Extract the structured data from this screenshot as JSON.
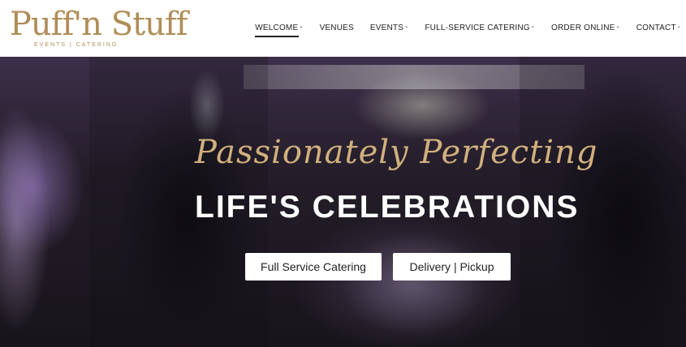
{
  "logo": {
    "main": "Puff'n Stuff",
    "sub": "EVENTS | CATERING"
  },
  "nav": {
    "items": [
      {
        "label": "WELCOME",
        "caret": "⌄"
      },
      {
        "label": "VENUES",
        "caret": ""
      },
      {
        "label": "EVENTS",
        "caret": "⌄"
      },
      {
        "label": "FULL-SERVICE CATERING",
        "caret": "⌄"
      },
      {
        "label": "ORDER ONLINE",
        "caret": "⌄"
      },
      {
        "label": "CONTACT",
        "caret": "⌄"
      }
    ]
  },
  "hero": {
    "script_line": "Passionately Perfecting",
    "main_line": "LIFE'S CELEBRATIONS",
    "buttons": {
      "full_service": "Full Service Catering",
      "delivery": "Delivery | Pickup"
    }
  },
  "colors": {
    "accent_gold": "#b08d57",
    "script_gold": "#d1b07d"
  }
}
